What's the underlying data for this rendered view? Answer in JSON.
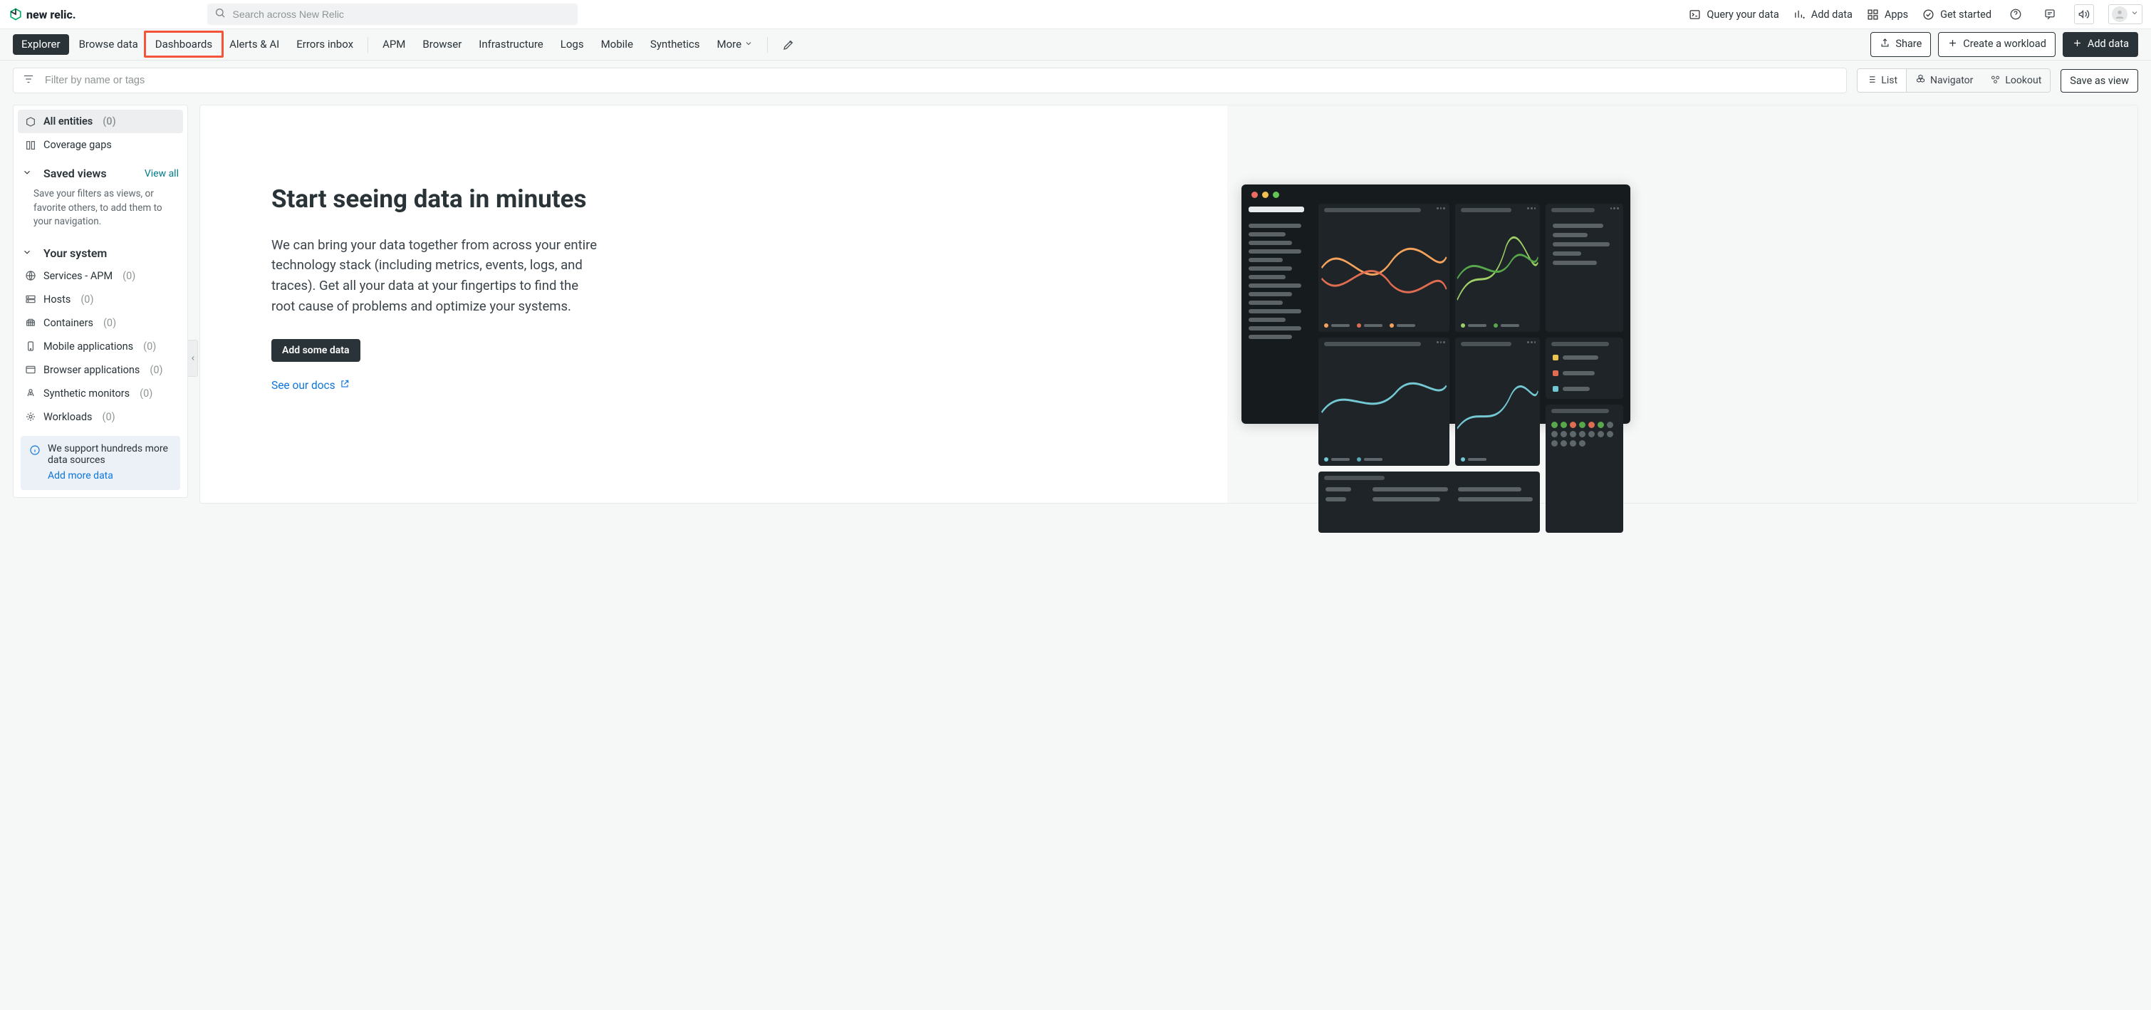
{
  "brand": {
    "name": "new relic."
  },
  "search": {
    "placeholder": "Search across New Relic"
  },
  "top_actions": {
    "query": "Query your data",
    "add_data": "Add data",
    "apps": "Apps",
    "get_started": "Get started"
  },
  "nav": {
    "primary": [
      "Explorer",
      "Browse data",
      "Dashboards",
      "Alerts & AI",
      "Errors inbox"
    ],
    "secondary": [
      "APM",
      "Browser",
      "Infrastructure",
      "Logs",
      "Mobile",
      "Synthetics"
    ],
    "more": "More",
    "share": "Share",
    "create_workload": "Create a workload",
    "add_data": "Add data",
    "highlighted": "Dashboards"
  },
  "filter": {
    "placeholder": "Filter by name or tags",
    "views": {
      "list": "List",
      "navigator": "Navigator",
      "lookout": "Lookout"
    },
    "save_view": "Save as view"
  },
  "sidebar": {
    "top": [
      {
        "icon": "entities",
        "label": "All entities",
        "count": "(0)"
      },
      {
        "icon": "coverage",
        "label": "Coverage gaps",
        "count": ""
      }
    ],
    "saved_views": {
      "title": "Saved views",
      "view_all": "View all",
      "help": "Save your filters as views, or favorite others, to add them to your navigation."
    },
    "system": {
      "title": "Your system",
      "items": [
        {
          "icon": "globe",
          "label": "Services - APM",
          "count": "(0)"
        },
        {
          "icon": "host",
          "label": "Hosts",
          "count": "(0)"
        },
        {
          "icon": "container",
          "label": "Containers",
          "count": "(0)"
        },
        {
          "icon": "mobile",
          "label": "Mobile applications",
          "count": "(0)"
        },
        {
          "icon": "browser",
          "label": "Browser applications",
          "count": "(0)"
        },
        {
          "icon": "synthetic",
          "label": "Synthetic monitors",
          "count": "(0)"
        },
        {
          "icon": "workload",
          "label": "Workloads",
          "count": "(0)"
        }
      ]
    },
    "info": {
      "text": "We support hundreds more data sources",
      "link": "Add more data"
    }
  },
  "hero": {
    "title": "Start seeing data in minutes",
    "body": "We can bring your data together from across your entire technology stack (including metrics, events, logs, and traces). Get all your data at your fingertips to find the root cause of problems and optimize your systems.",
    "cta": "Add some data",
    "docs": "See our docs"
  },
  "colors": {
    "accent": "#017c86",
    "link": "#0c75dd",
    "highlight": "#f3543a"
  }
}
